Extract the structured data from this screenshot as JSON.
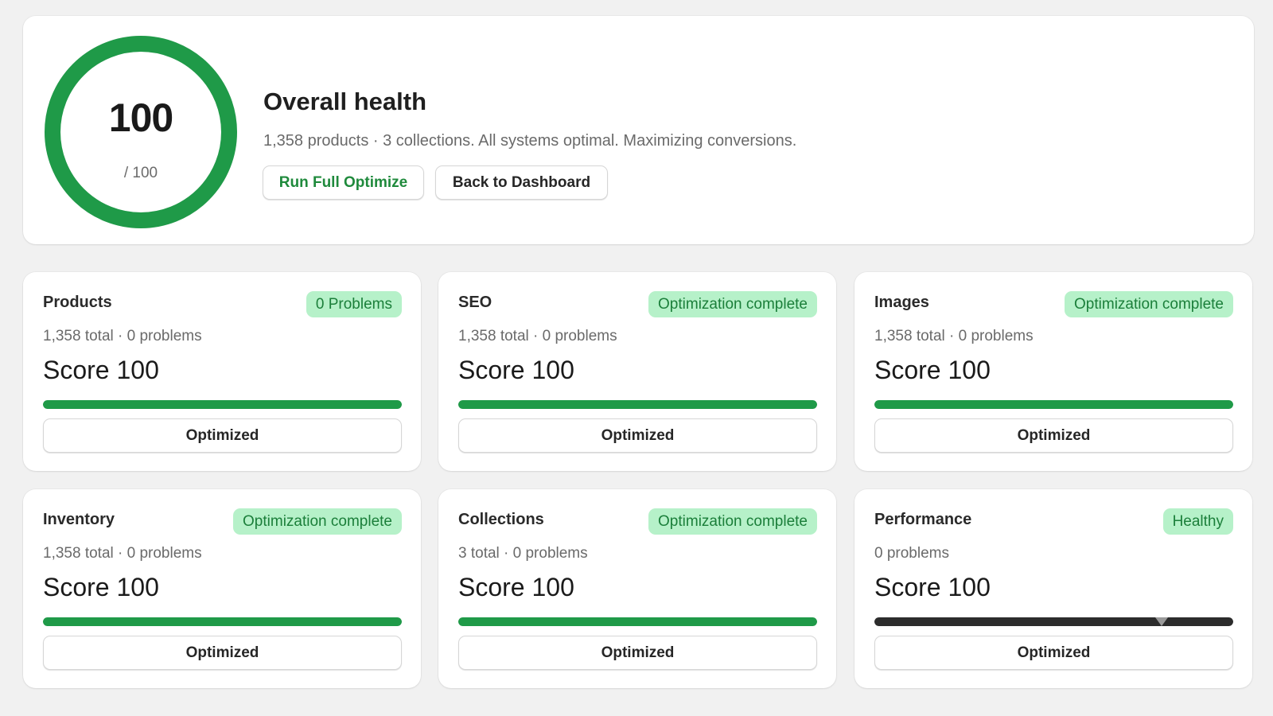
{
  "overall": {
    "score": "100",
    "score_value": 100,
    "score_max": "/ 100",
    "title": "Overall health",
    "subtitle": "1,358 products · 3 collections. All systems optimal. Maximizing conversions.",
    "run_button_label": "Run Full Optimize",
    "back_button_label": "Back to Dashboard"
  },
  "cards": [
    {
      "title": "Products",
      "badge": "0 Problems",
      "meta": "1,358 total · 0 problems",
      "score": "Score 100",
      "progress": 100,
      "bar_style": "green",
      "button": "Optimized"
    },
    {
      "title": "SEO",
      "badge": "Optimization complete",
      "meta": "1,358 total · 0 problems",
      "score": "Score 100",
      "progress": 100,
      "bar_style": "green",
      "button": "Optimized"
    },
    {
      "title": "Images",
      "badge": "Optimization complete",
      "meta": "1,358 total · 0 problems",
      "score": "Score 100",
      "progress": 100,
      "bar_style": "green",
      "button": "Optimized"
    },
    {
      "title": "Inventory",
      "badge": "Optimization complete",
      "meta": "1,358 total · 0 problems",
      "score": "Score 100",
      "progress": 100,
      "bar_style": "green",
      "button": "Optimized"
    },
    {
      "title": "Collections",
      "badge": "Optimization complete",
      "meta": "3 total · 0 problems",
      "score": "Score 100",
      "progress": 100,
      "bar_style": "green",
      "button": "Optimized"
    },
    {
      "title": "Performance",
      "badge": "Healthy",
      "meta": "0 problems",
      "score": "Score 100",
      "progress": 100,
      "bar_style": "dark",
      "button": "Optimized"
    }
  ],
  "colors": {
    "accent_green": "#1f9a48",
    "badge_bg": "#b6f1c9",
    "badge_text": "#1b7f3a",
    "dark_bar": "#2c2c2c"
  }
}
